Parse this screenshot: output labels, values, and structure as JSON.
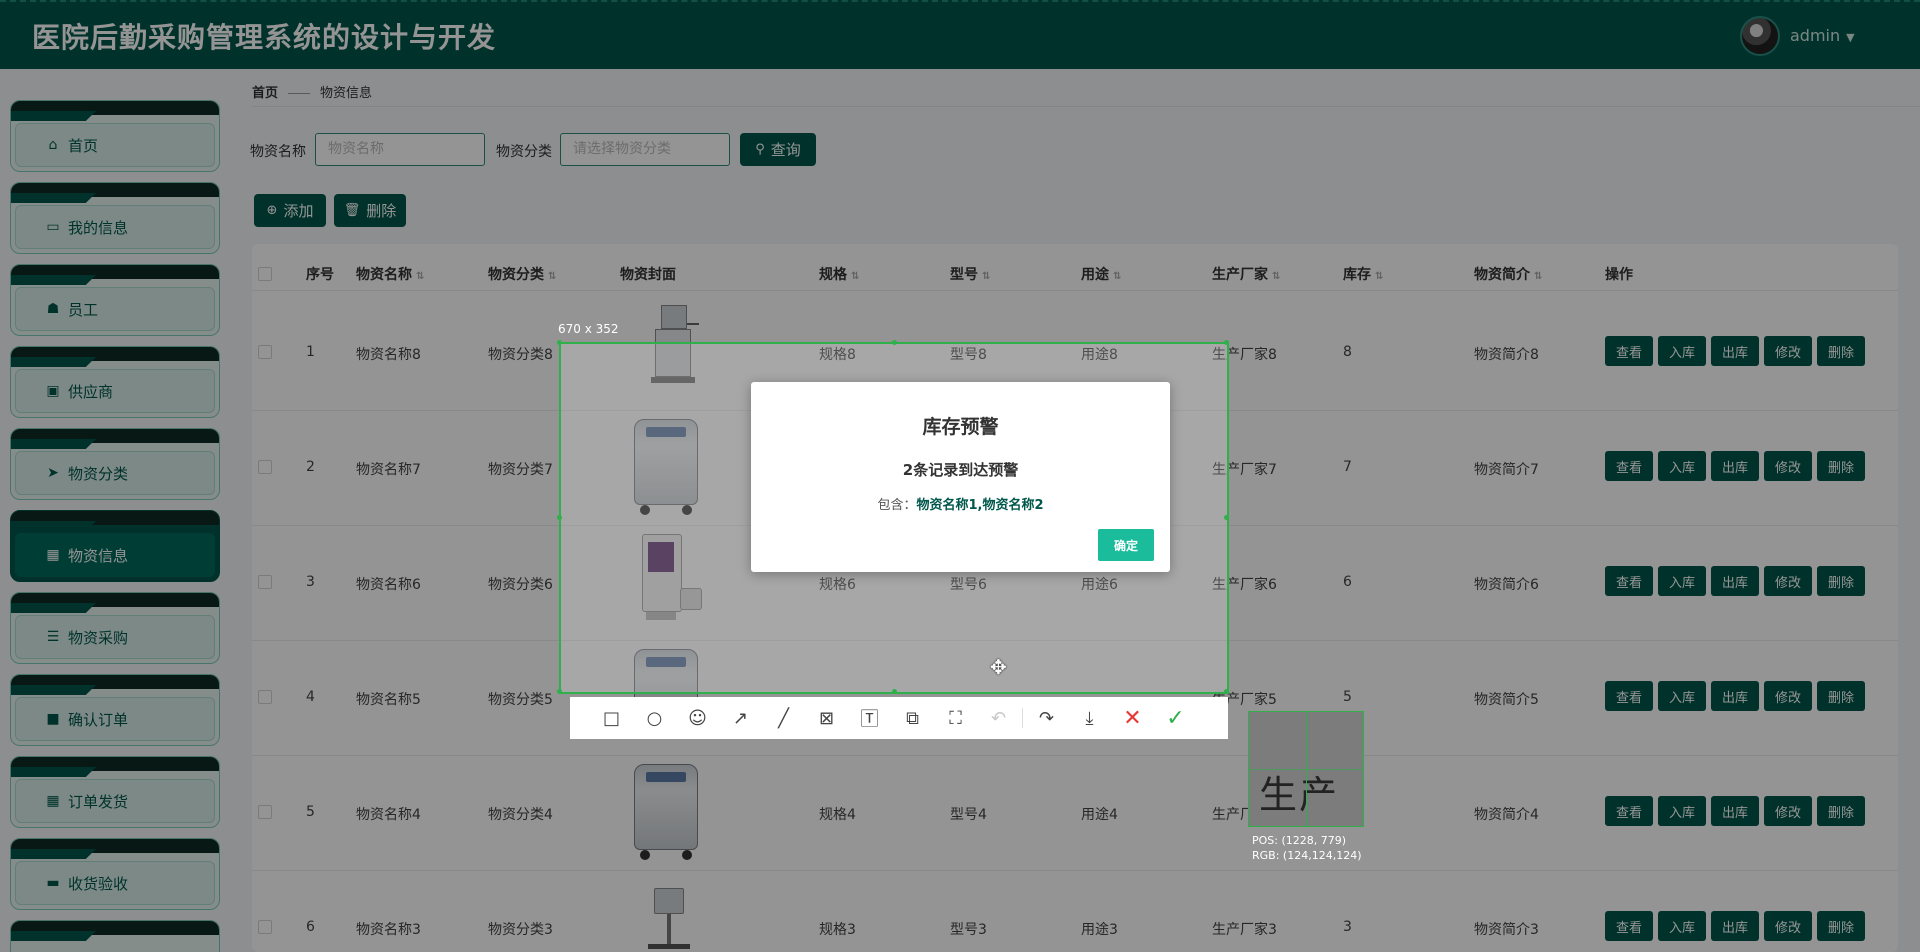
{
  "header": {
    "title": "医院后勤采购管理系统的设计与开发",
    "username": "admin"
  },
  "sidebar": {
    "items": [
      {
        "label": "首页",
        "icon": "home-icon"
      },
      {
        "label": "我的信息",
        "icon": "id-card-icon"
      },
      {
        "label": "员工",
        "icon": "user-icon"
      },
      {
        "label": "供应商",
        "icon": "clipboard-icon"
      },
      {
        "label": "物资分类",
        "icon": "send-icon"
      },
      {
        "label": "物资信息",
        "icon": "grid-icon",
        "active": true
      },
      {
        "label": "物资采购",
        "icon": "sliders-icon"
      },
      {
        "label": "确认订单",
        "icon": "printer-icon"
      },
      {
        "label": "订单发货",
        "icon": "grid-icon"
      },
      {
        "label": "收货验收",
        "icon": "message-icon"
      }
    ]
  },
  "breadcrumb": {
    "home": "首页",
    "current": "物资信息"
  },
  "search": {
    "name_label": "物资名称",
    "name_placeholder": "物资名称",
    "category_label": "物资分类",
    "category_placeholder": "请选择物资分类",
    "query_button": "查询"
  },
  "actions": {
    "add": "添加",
    "delete": "删除"
  },
  "table": {
    "headers": [
      "序号",
      "物资名称",
      "物资分类",
      "物资封面",
      "规格",
      "型号",
      "用途",
      "生产厂家",
      "库存",
      "物资简介",
      "操作"
    ],
    "row_actions": [
      "查看",
      "入库",
      "出库",
      "修改",
      "删除"
    ],
    "rows": [
      {
        "no": "1",
        "name": "物资名称8",
        "category": "物资分类8",
        "spec": "规格8",
        "model": "型号8",
        "usage": "用途8",
        "maker": "生产厂家8",
        "stock": "8",
        "intro": "物资简介8"
      },
      {
        "no": "2",
        "name": "物资名称7",
        "category": "物资分类7",
        "spec": "",
        "model": "",
        "usage": "",
        "maker": "生产厂家7",
        "stock": "7",
        "intro": "物资简介7"
      },
      {
        "no": "3",
        "name": "物资名称6",
        "category": "物资分类6",
        "spec": "规格6",
        "model": "型号6",
        "usage": "用途6",
        "maker": "生产厂家6",
        "stock": "6",
        "intro": "物资简介6"
      },
      {
        "no": "4",
        "name": "物资名称5",
        "category": "物资分类5",
        "spec": "",
        "model": "",
        "usage": "",
        "maker": "生产厂家5",
        "stock": "5",
        "intro": "物资简介5"
      },
      {
        "no": "5",
        "name": "物资名称4",
        "category": "物资分类4",
        "spec": "规格4",
        "model": "型号4",
        "usage": "用途4",
        "maker": "生产厂",
        "stock": "",
        "intro": "物资简介4"
      },
      {
        "no": "6",
        "name": "物资名称3",
        "category": "物资分类3",
        "spec": "规格3",
        "model": "型号3",
        "usage": "用途3",
        "maker": "生产厂家3",
        "stock": "3",
        "intro": "物资简介3"
      }
    ]
  },
  "modal": {
    "title": "库存预警",
    "subtitle": "2条记录到达预警",
    "include_label": "包含：",
    "include_items": "物资名称1,物资名称2",
    "ok": "确定"
  },
  "screenshot_tool": {
    "size": "670 x 352",
    "magnifier_text": "生产厂",
    "pos": "POS:  (1228, 779)",
    "rgb": "RGB:  (124,124,124)",
    "tools": [
      "rectangle-icon",
      "ellipse-icon",
      "emoji-icon",
      "arrow-icon",
      "line-icon",
      "mosaic-icon",
      "text-icon",
      "pin-icon",
      "ocr-icon",
      "undo-icon",
      "redo-icon",
      "save-icon",
      "cancel-icon",
      "confirm-icon"
    ]
  },
  "colors": {
    "primary": "#00574b",
    "accent": "#1abc9c",
    "selection": "#2fb04b"
  }
}
